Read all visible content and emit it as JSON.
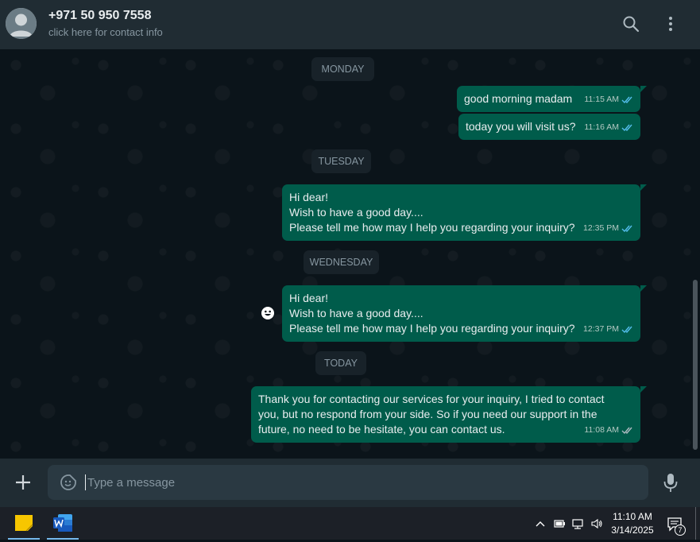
{
  "header": {
    "contact_name": "+971 50 950 7558",
    "contact_sub": "click here for contact info",
    "icons": [
      "search-icon",
      "more-vertical-icon"
    ]
  },
  "chat": {
    "dates": {
      "monday": "MONDAY",
      "tuesday": "TUESDAY",
      "wednesday": "WEDNESDAY",
      "today": "TODAY"
    },
    "messages": [
      {
        "text": "good morning madam",
        "time": "11:15 AM",
        "status": "read"
      },
      {
        "text": "today you will visit us?",
        "time": "11:16 AM",
        "status": "read"
      },
      {
        "text": "Hi dear!\nWish to have a good day....\nPlease tell me how may I help you regarding your inquiry?",
        "time": "12:35 PM",
        "status": "read"
      },
      {
        "text": "Hi dear!\nWish to have a good day....\nPlease tell me how may I help you regarding your inquiry?",
        "time": "12:37 PM",
        "status": "read"
      },
      {
        "text": "Thank you for contacting our services for your inquiry, I tried to contact\nyou, but no respond from your side. So if you need our support in the\nfuture, no need to be hesitate, you can contact us.",
        "time": "11:08 AM",
        "status": "delivered"
      }
    ],
    "colors": {
      "outgoing": "#005c4b",
      "read_tick": "#53bdeb",
      "background": "#0b141a"
    }
  },
  "composer": {
    "placeholder": "Type a message",
    "value": ""
  },
  "taskbar": {
    "apps": [
      "sticky-notes-icon",
      "word-icon"
    ],
    "time": "11:10 AM",
    "date": "3/14/2025",
    "notifications": "7"
  }
}
